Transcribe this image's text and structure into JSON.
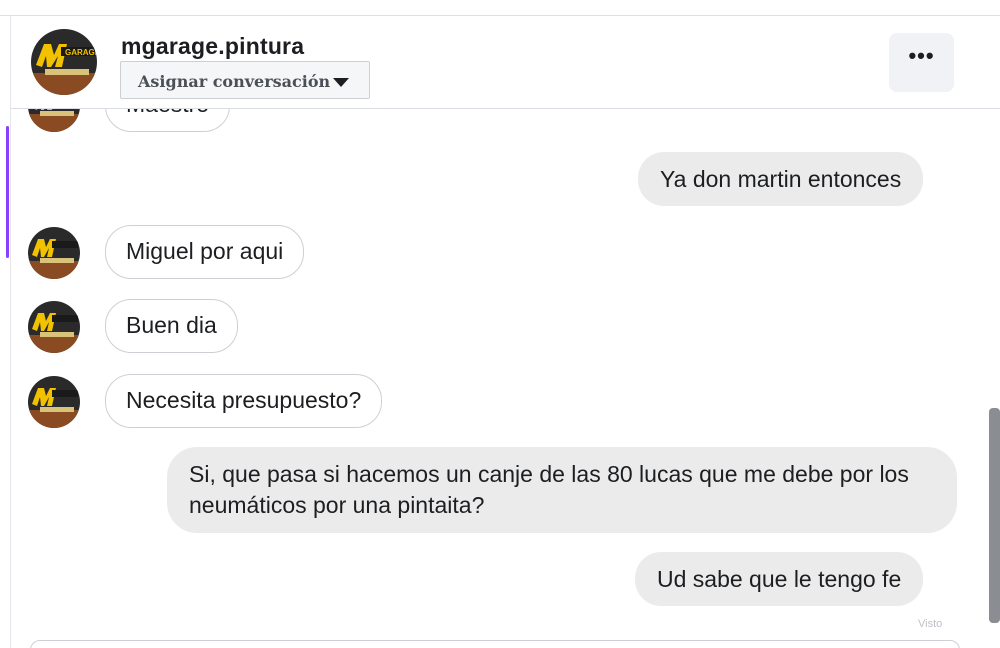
{
  "header": {
    "title": "mgarage.pintura",
    "assign_label": "Asignar conversación",
    "more_label": "•••"
  },
  "messages": [
    {
      "direction": "in",
      "text": "Maestro"
    },
    {
      "direction": "out",
      "text": "Ya don martin entonces"
    },
    {
      "direction": "in",
      "text": "Miguel por aqui"
    },
    {
      "direction": "in",
      "text": "Buen dia"
    },
    {
      "direction": "in",
      "text": "Necesita presupuesto?"
    },
    {
      "direction": "out",
      "text": "Si, que pasa si hacemos un canje de las 80 lucas que me debe por los neumáticos por una pintaita?"
    },
    {
      "direction": "out",
      "text": "Ud sabe que le tengo fe"
    }
  ],
  "seen_hint": "Visto",
  "colors": {
    "accent": "#8a3ffc",
    "outgoing_bubble": "#ebebeb",
    "incoming_border": "#ccd0d5",
    "logo_yellow": "#f2c200"
  },
  "icons": {
    "avatar": "mgarage-logo-avatar",
    "assign": "chevron-down-icon",
    "more": "more-dots-icon"
  }
}
